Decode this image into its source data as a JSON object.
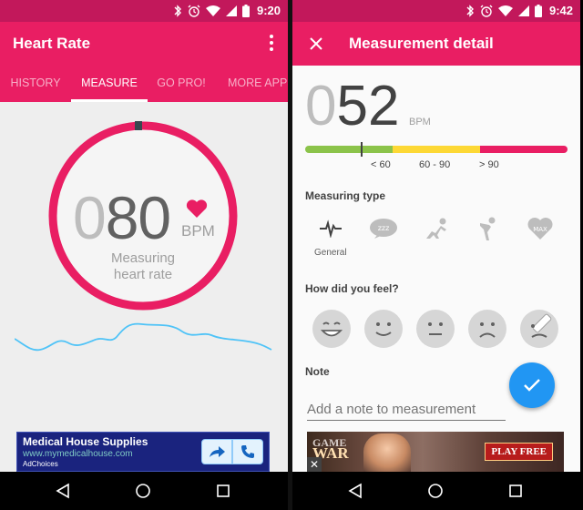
{
  "left": {
    "status": {
      "time": "9:20"
    },
    "app_title": "Heart Rate",
    "tabs": [
      {
        "label": "HISTORY",
        "active": false
      },
      {
        "label": "MEASURE",
        "active": true
      },
      {
        "label": "GO PRO!",
        "active": false
      },
      {
        "label": "MORE APPS",
        "active": false
      }
    ],
    "bpm": {
      "leading": "0",
      "digits": "80",
      "unit": "BPM"
    },
    "measuring_line1": "Measuring",
    "measuring_line2": "heart rate",
    "ad": {
      "title": "Medical House Supplies",
      "url": "www.mymedicalhouse.com",
      "choices": "AdChoices"
    }
  },
  "right": {
    "status": {
      "time": "9:42"
    },
    "title": "Measurement detail",
    "bpm": {
      "leading": "0",
      "digits": "52",
      "unit": "BPM"
    },
    "scale": {
      "labels": [
        "< 60",
        "60 - 90",
        "> 90"
      ],
      "colors": {
        "low": "#8bc34a",
        "normal": "#fdd835",
        "high": "#e91e63"
      }
    },
    "measuring_type_label": "Measuring type",
    "types": [
      {
        "icon": "pulse-icon",
        "caption": "General",
        "selected": true
      },
      {
        "icon": "sleep-icon",
        "caption": "",
        "selected": false
      },
      {
        "icon": "runner-start-icon",
        "caption": "",
        "selected": false
      },
      {
        "icon": "stretch-icon",
        "caption": "",
        "selected": false
      },
      {
        "icon": "heart-max-icon",
        "caption": "MAX",
        "selected": false
      }
    ],
    "feel_label": "How did you feel?",
    "note_label": "Note",
    "note_placeholder": "Add a note to measurement",
    "ad": {
      "game_line1": "GAME",
      "game_line2": "WAR",
      "cta": "PLAY FREE",
      "close": "✕"
    }
  },
  "colors": {
    "primary": "#e91e63",
    "primary_dark": "#c2185b",
    "fab": "#2196f3",
    "wave": "#4fc3f7"
  }
}
